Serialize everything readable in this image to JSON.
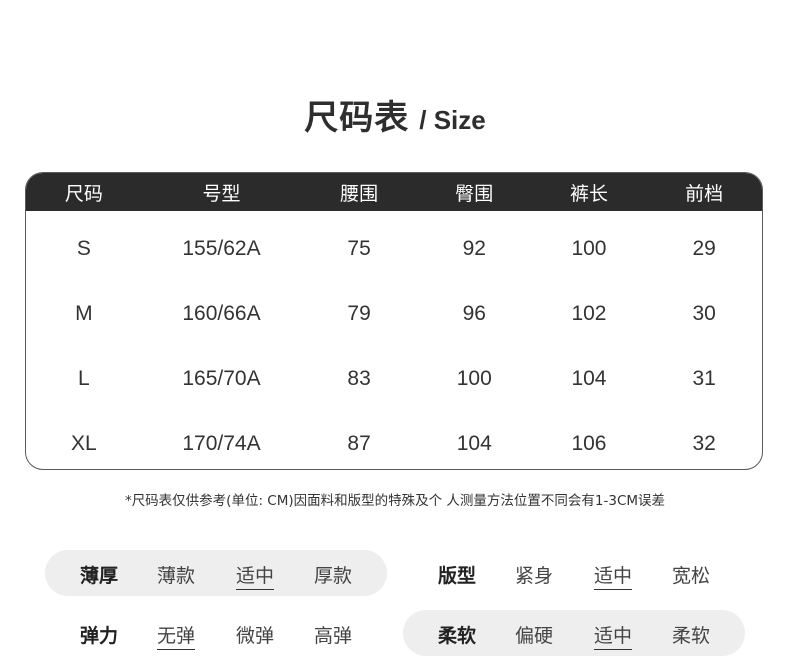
{
  "title": {
    "cn": "尺码表",
    "en": "/ Size"
  },
  "table": {
    "headers": [
      "尺码",
      "号型",
      "腰围",
      "臀围",
      "裤长",
      "前档"
    ],
    "rows": [
      [
        "S",
        "155/62A",
        "75",
        "92",
        "100",
        "29"
      ],
      [
        "M",
        "160/66A",
        "79",
        "96",
        "102",
        "30"
      ],
      [
        "L",
        "165/70A",
        "83",
        "100",
        "104",
        "31"
      ],
      [
        "XL",
        "170/74A",
        "87",
        "104",
        "106",
        "32"
      ]
    ]
  },
  "note": "*尺码表仅供参考(单位: CM)因面料和版型的特殊及个 人测量方法位置不同会有1-3CM误差",
  "attributes": {
    "thickness": {
      "label": "薄厚",
      "options": [
        "薄款",
        "适中",
        "厚款"
      ],
      "selected": "适中"
    },
    "fit": {
      "label": "版型",
      "options": [
        "紧身",
        "适中",
        "宽松"
      ],
      "selected": "适中"
    },
    "elasticity": {
      "label": "弹力",
      "options": [
        "无弹",
        "微弹",
        "高弹"
      ],
      "selected": "无弹"
    },
    "softness": {
      "label": "柔软",
      "options": [
        "偏硬",
        "适中",
        "柔软"
      ],
      "selected": "适中"
    }
  },
  "colors": {
    "header_bg": "#2b2b2b",
    "pill_bg": "#eeeeee",
    "text": "#333333"
  }
}
